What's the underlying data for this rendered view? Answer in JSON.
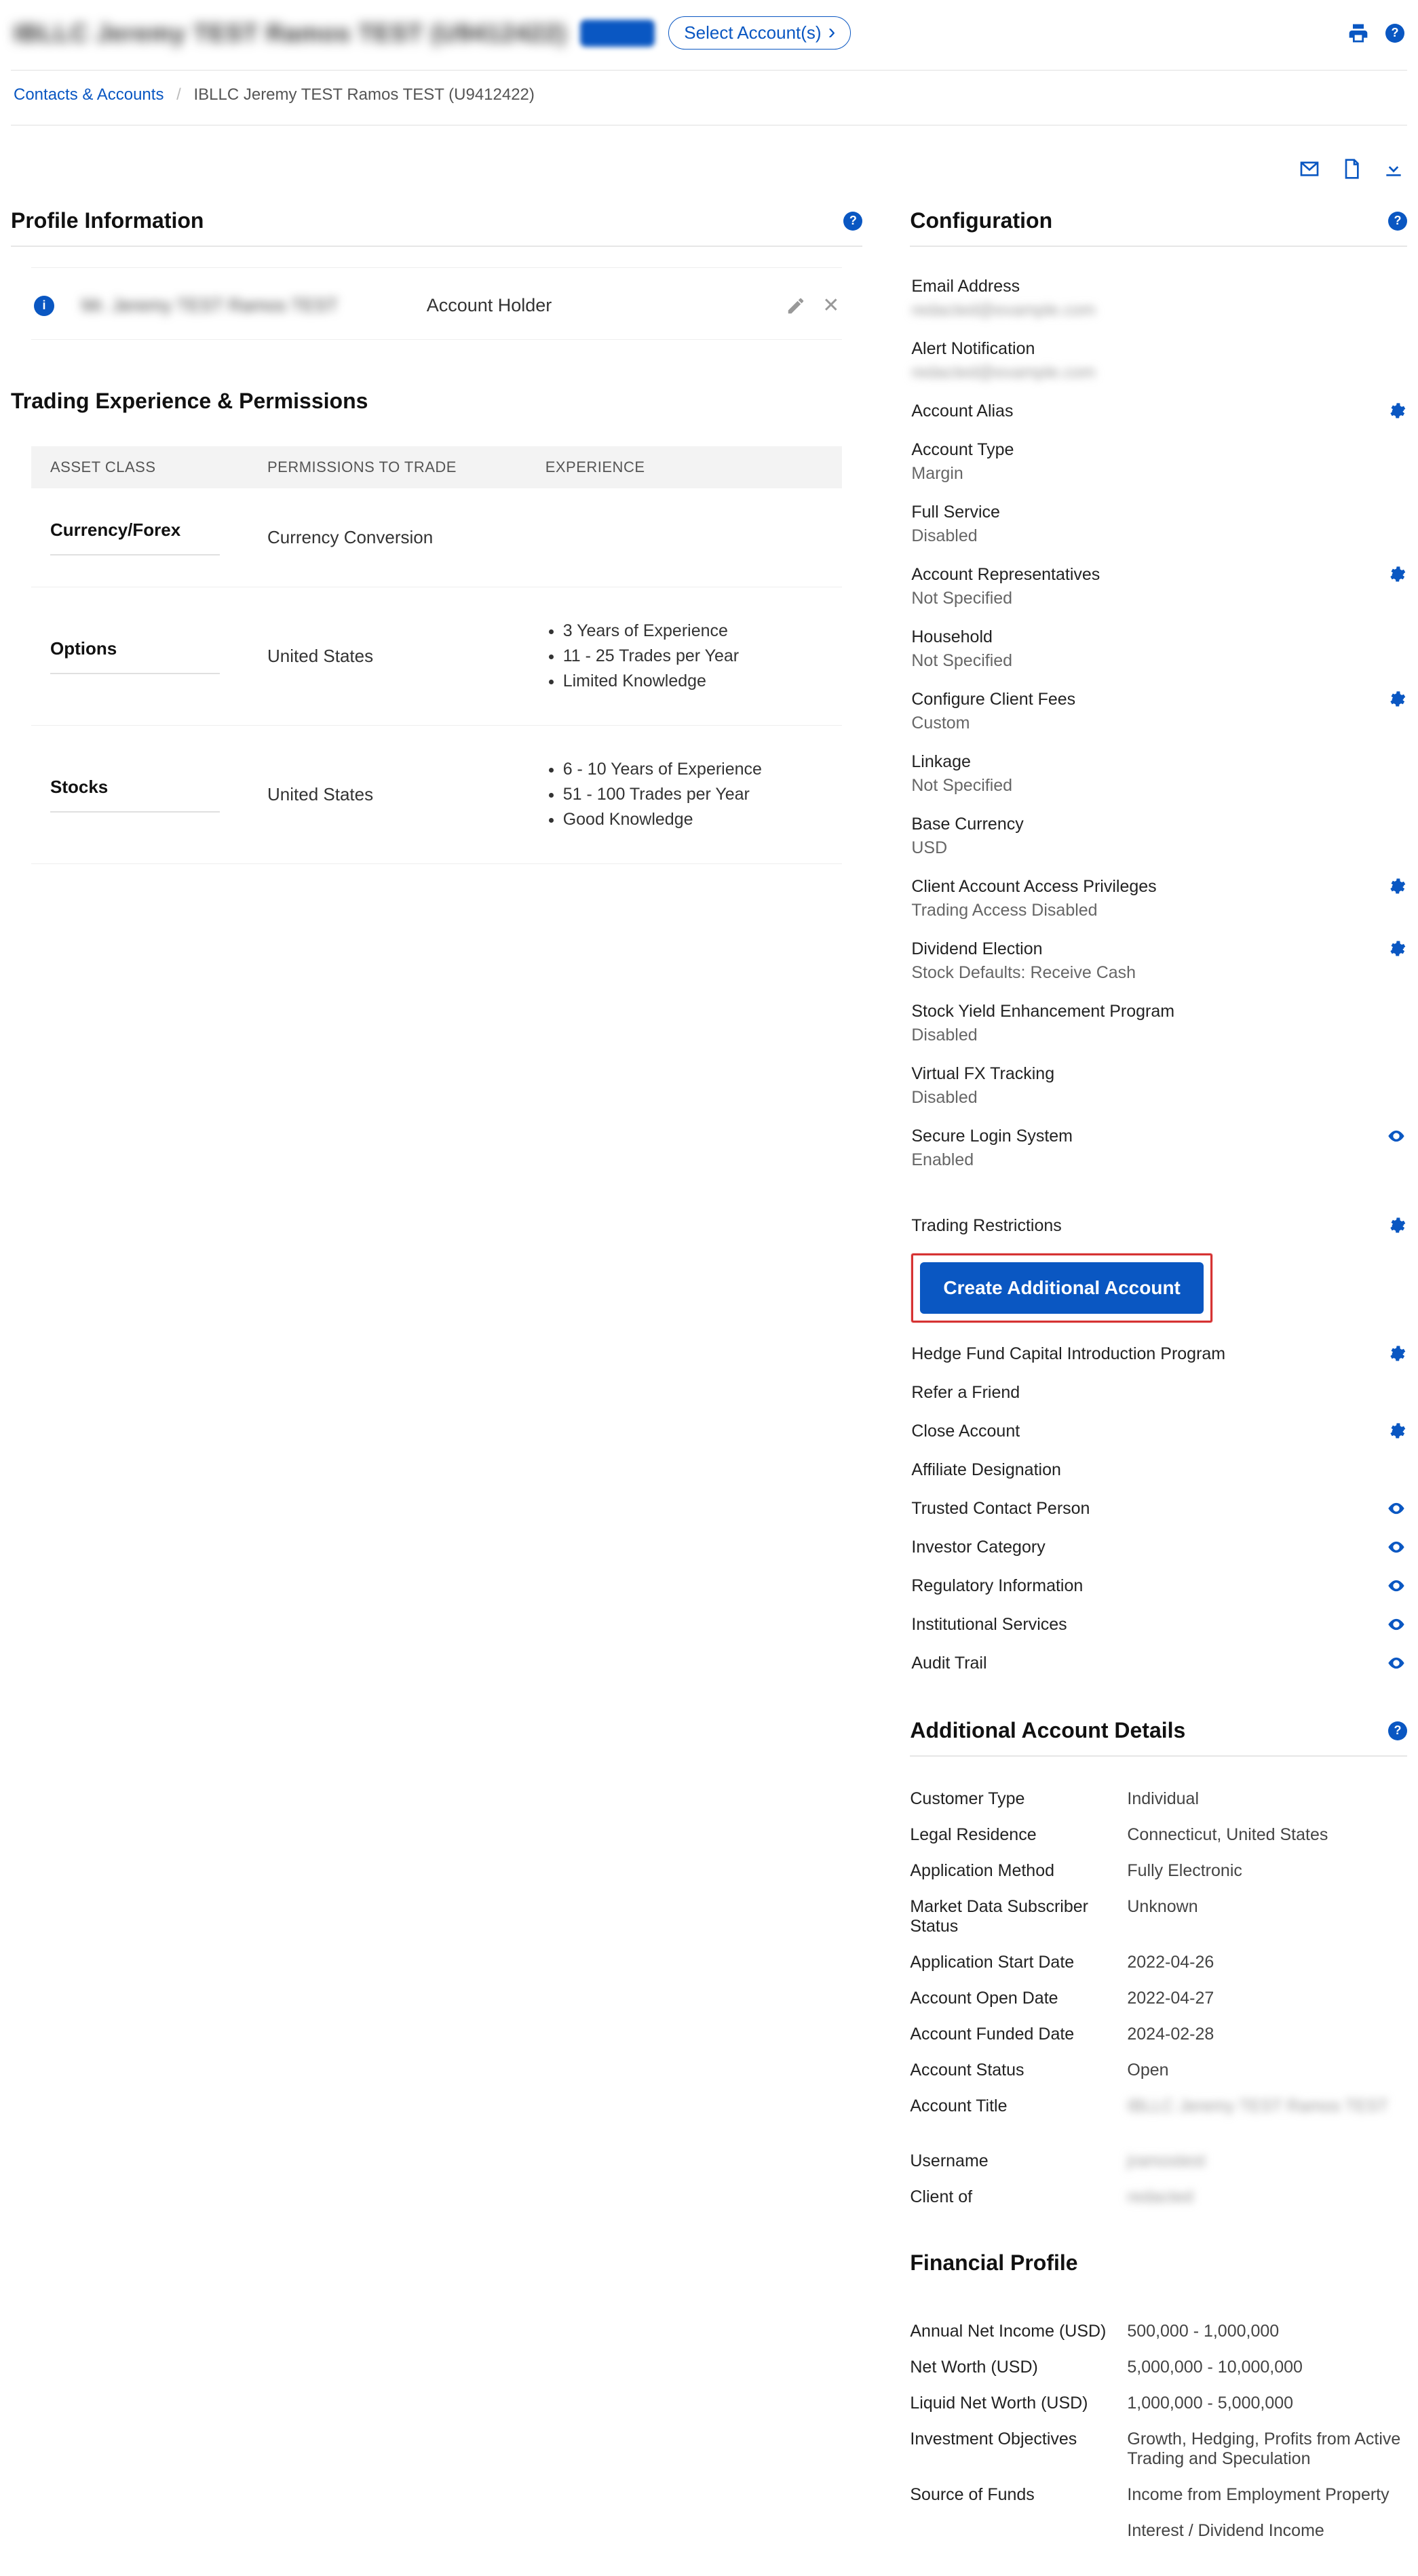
{
  "header": {
    "account_title_blur": "IBLLC Jeremy TEST Ramos TEST (U9412422)",
    "select_account": "Select Account(s)"
  },
  "breadcrumb": {
    "root": "Contacts & Accounts",
    "current": "IBLLC Jeremy TEST Ramos TEST (U9412422)"
  },
  "profile": {
    "section_title": "Profile Information",
    "name_blur": "Mr. Jeremy TEST Ramos TEST",
    "role": "Account Holder"
  },
  "tep": {
    "section_title": "Trading Experience & Permissions",
    "col_asset": "ASSET CLASS",
    "col_perm": "PERMISSIONS TO TRADE",
    "col_exp": "EXPERIENCE",
    "rows": [
      {
        "asset": "Currency/Forex",
        "perm": "Currency Conversion",
        "exp": []
      },
      {
        "asset": "Options",
        "perm": "United States",
        "exp": [
          "3 Years of Experience",
          "11 - 25 Trades per Year",
          "Limited Knowledge"
        ]
      },
      {
        "asset": "Stocks",
        "perm": "United States",
        "exp": [
          "6 - 10 Years of Experience",
          "51 - 100 Trades per Year",
          "Good Knowledge"
        ]
      }
    ]
  },
  "config": {
    "section_title": "Configuration",
    "email_label": "Email Address",
    "email_value": "redacted@example.com",
    "alert_label": "Alert Notification",
    "alert_value": "redacted@example.com",
    "alias_label": "Account Alias",
    "type_label": "Account Type",
    "type_value": "Margin",
    "full_service_label": "Full Service",
    "full_service_value": "Disabled",
    "reps_label": "Account Representatives",
    "reps_value": "Not Specified",
    "household_label": "Household",
    "household_value": "Not Specified",
    "fees_label": "Configure Client Fees",
    "fees_value": "Custom",
    "linkage_label": "Linkage",
    "linkage_value": "Not Specified",
    "base_label": "Base Currency",
    "base_value": "USD",
    "access_label": "Client Account Access Privileges",
    "access_value": "Trading Access Disabled",
    "dividend_label": "Dividend Election",
    "dividend_value": "Stock Defaults: Receive Cash",
    "syep_label": "Stock Yield Enhancement Program",
    "syep_value": "Disabled",
    "vfx_label": "Virtual FX Tracking",
    "vfx_value": "Disabled",
    "sls_label": "Secure Login System",
    "sls_value": "Enabled",
    "restrictions_label": "Trading Restrictions",
    "create_btn": "Create Additional Account",
    "hedge_label": "Hedge Fund Capital Introduction Program",
    "refer_label": "Refer a Friend",
    "close_label": "Close Account",
    "affiliate_label": "Affiliate Designation",
    "trusted_label": "Trusted Contact Person",
    "investor_label": "Investor Category",
    "regulatory_label": "Regulatory Information",
    "institutional_label": "Institutional Services",
    "audit_label": "Audit Trail"
  },
  "details": {
    "section_title": "Additional Account Details",
    "rows": [
      {
        "label": "Customer Type",
        "value": "Individual"
      },
      {
        "label": "Legal Residence",
        "value": "Connecticut, United States"
      },
      {
        "label": "Application Method",
        "value": "Fully Electronic"
      },
      {
        "label": "Market Data Subscriber Status",
        "value": "Unknown"
      },
      {
        "label": "Application Start Date",
        "value": "2022-04-26"
      },
      {
        "label": "Account Open Date",
        "value": "2022-04-27"
      },
      {
        "label": "Account Funded Date",
        "value": "2024-02-28"
      },
      {
        "label": "Account Status",
        "value": "Open"
      }
    ],
    "title_label": "Account Title",
    "title_value": "IBLLC Jeremy TEST Ramos TEST",
    "username_label": "Username",
    "username_value": "jramostest",
    "clientof_label": "Client of",
    "clientof_value": "redacted"
  },
  "financial": {
    "section_title": "Financial Profile",
    "rows": [
      {
        "label": "Annual Net Income (USD)",
        "value": "500,000 - 1,000,000"
      },
      {
        "label": "Net Worth (USD)",
        "value": "5,000,000 - 10,000,000"
      },
      {
        "label": "Liquid Net Worth (USD)",
        "value": "1,000,000 - 5,000,000"
      },
      {
        "label": "Investment Objectives",
        "value": "Growth, Hedging, Profits from Active Trading and Speculation"
      },
      {
        "label": "Source of Funds",
        "value": "Income from Employment Property"
      }
    ],
    "extra_value": "Interest / Dividend Income"
  }
}
